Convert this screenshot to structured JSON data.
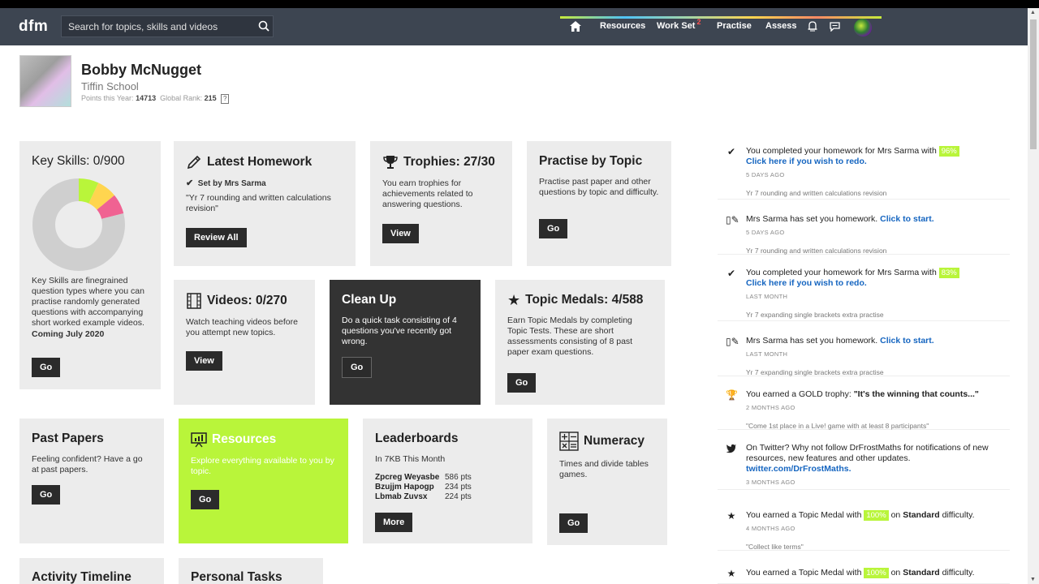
{
  "app": {
    "logo": "dfm"
  },
  "search": {
    "placeholder": "Search for topics, skills and videos"
  },
  "nav": {
    "resources": "Resources",
    "workset": "Work Set",
    "workset_badge": "2",
    "practise": "Practise",
    "assess": "Assess"
  },
  "profile": {
    "name": "Bobby McNugget",
    "school": "Tiffin School",
    "points_label": "Points this Year:",
    "points": "14713",
    "rank_label": "Global Rank:",
    "rank": "215",
    "help": "?"
  },
  "cards": {
    "key_skills": {
      "title": "Key Skills: 0/900",
      "text": "Key Skills are finegrained question types where you can practise randomly generated questions with accompanying short worked example videos.",
      "coming": "Coming July 2020",
      "button": "Go",
      "donut": {
        "segments": [
          {
            "value": 0.07,
            "color": "#b9f53a"
          },
          {
            "value": 0.07,
            "color": "#ffd54f"
          },
          {
            "value": 0.07,
            "color": "#f06292"
          },
          {
            "value": 0.79,
            "color": "#cfcfcf"
          }
        ]
      }
    },
    "homework": {
      "title": "Latest Homework",
      "set_by": "Set by Mrs Sarma",
      "desc": "\"Yr 7 rounding and written calculations revision\"",
      "button": "Review All"
    },
    "trophies": {
      "title": "Trophies: 27/30",
      "text": "You earn trophies for achievements related to answering questions.",
      "button": "View"
    },
    "practise_topic": {
      "title": "Practise by Topic",
      "text": "Practise past paper and other questions by topic and difficulty.",
      "button": "Go"
    },
    "videos": {
      "title": "Videos: 0/270",
      "text": "Watch teaching videos before you attempt new topics.",
      "button": "View"
    },
    "cleanup": {
      "title": "Clean Up",
      "text": "Do a quick task consisting of 4 questions you've recently got wrong.",
      "button": "Go"
    },
    "medals": {
      "title": "Topic Medals: 4/588",
      "text": "Earn Topic Medals by completing Topic Tests. These are short assessments consisting of 8 past paper exam questions.",
      "button": "Go"
    },
    "past_papers": {
      "title": "Past Papers",
      "text": "Feeling confident? Have a go at past papers.",
      "button": "Go"
    },
    "resources": {
      "title": "Resources",
      "text": "Explore everything available to you by topic.",
      "button": "Go"
    },
    "leaderboards": {
      "title": "Leaderboards",
      "subtitle": "In 7KB This Month",
      "rows": [
        {
          "name": "Zpcreg Weyasbe",
          "pts": "586 pts"
        },
        {
          "name": "Bzujjm Hapogp",
          "pts": "234 pts"
        },
        {
          "name": "Lbmab Zuvsx",
          "pts": "224 pts"
        }
      ],
      "button": "More"
    },
    "numeracy": {
      "title": "Numeracy",
      "text": "Times and divide tables games.",
      "button": "Go"
    }
  },
  "feed": [
    {
      "pre": "You completed your homework for Mrs Sarma with ",
      "pct": "96%",
      "link": "Click here if you wish to redo.",
      "time": "5 DAYS AGO",
      "sub": "Yr 7 rounding and written calculations revision"
    },
    {
      "pre": "Mrs Sarma has set you homework. ",
      "link": "Click to start.",
      "time": "5 DAYS AGO",
      "sub": "Yr 7 rounding and written calculations revision"
    },
    {
      "pre": "You completed your homework for Mrs Sarma with ",
      "pct": "83%",
      "link": "Click here if you wish to redo.",
      "time": "LAST MONTH",
      "sub": "Yr 7 expanding single brackets extra practise"
    },
    {
      "pre": "Mrs Sarma has set you homework. ",
      "link": "Click to start.",
      "time": "LAST MONTH",
      "sub": "Yr 7 expanding single brackets extra practise"
    },
    {
      "pre": "You earned a GOLD trophy: ",
      "bold": "\"It's the winning that counts...\"",
      "time": "2 MONTHS AGO",
      "sub": "\"Come 1st place in a Live! game with at least 8 participants\""
    },
    {
      "pre": "On Twitter? Why not follow DrFrostMaths for notifications of new resources, new features and other updates.",
      "link": "twitter.com/DrFrostMaths.",
      "time": "3 MONTHS AGO"
    },
    {
      "pre": "You earned a Topic Medal with ",
      "pct": "100%",
      "mid": " on ",
      "bold": "Standard",
      "post": " difficulty.",
      "time": "4 MONTHS AGO",
      "sub": "\"Collect like terms\""
    },
    {
      "pre": "You earned a Topic Medal with ",
      "pct": "100%",
      "mid": " on ",
      "bold": "Standard",
      "post": " difficulty."
    }
  ],
  "bottom_cards": {
    "activity": "Activity Timeline",
    "tasks": "Personal Tasks"
  }
}
